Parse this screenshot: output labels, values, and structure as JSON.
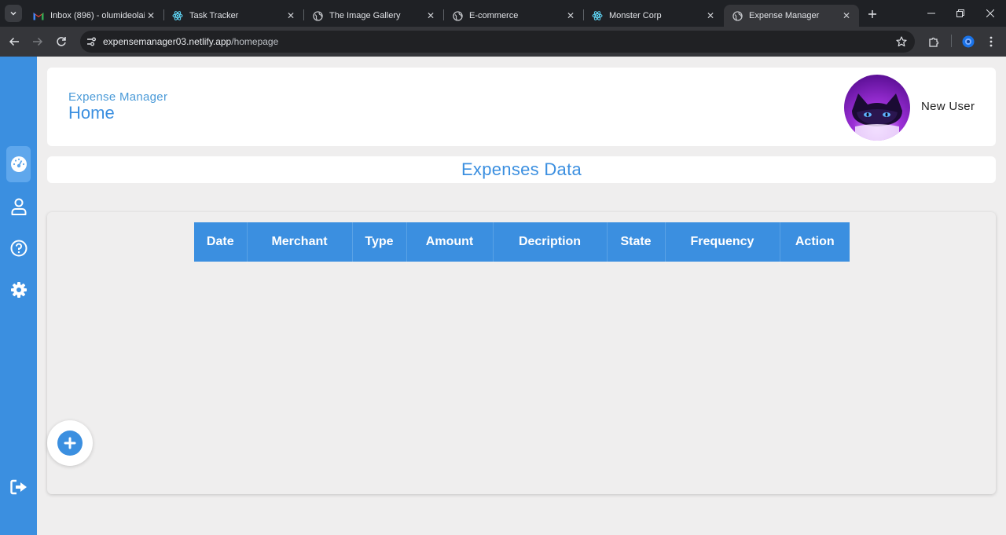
{
  "browser": {
    "tabs": [
      {
        "title": "Inbox (896) - olumideolaiy",
        "icon": "gmail-icon"
      },
      {
        "title": "Task Tracker",
        "icon": "react-icon"
      },
      {
        "title": "The Image Gallery",
        "icon": "globe-icon"
      },
      {
        "title": "E-commerce",
        "icon": "globe-icon"
      },
      {
        "title": "Monster Corp",
        "icon": "react-icon"
      },
      {
        "title": "Expense Manager",
        "icon": "globe-icon",
        "active": true
      }
    ],
    "url_domain": "expensemanager03.netlify.app",
    "url_path": "/homepage"
  },
  "sidebar": {
    "items": [
      {
        "name": "dashboard",
        "icon": "gauge-icon",
        "active": true
      },
      {
        "name": "profile",
        "icon": "user-icon"
      },
      {
        "name": "help",
        "icon": "question-icon"
      },
      {
        "name": "settings",
        "icon": "gear-icon"
      }
    ],
    "logout_icon": "logout-icon",
    "color": "#3b8fe0"
  },
  "header": {
    "subtitle": "Expense Manager",
    "title": "Home",
    "user_name": "New User"
  },
  "section": {
    "title": "Expenses Data"
  },
  "table": {
    "columns": [
      "Date",
      "Merchant",
      "Type",
      "Amount",
      "Decription",
      "State",
      "Frequency",
      "Action"
    ],
    "rows": []
  },
  "fab": {
    "icon": "plus-icon"
  },
  "colors": {
    "accent": "#3b8fe0",
    "background": "#efeeee"
  }
}
